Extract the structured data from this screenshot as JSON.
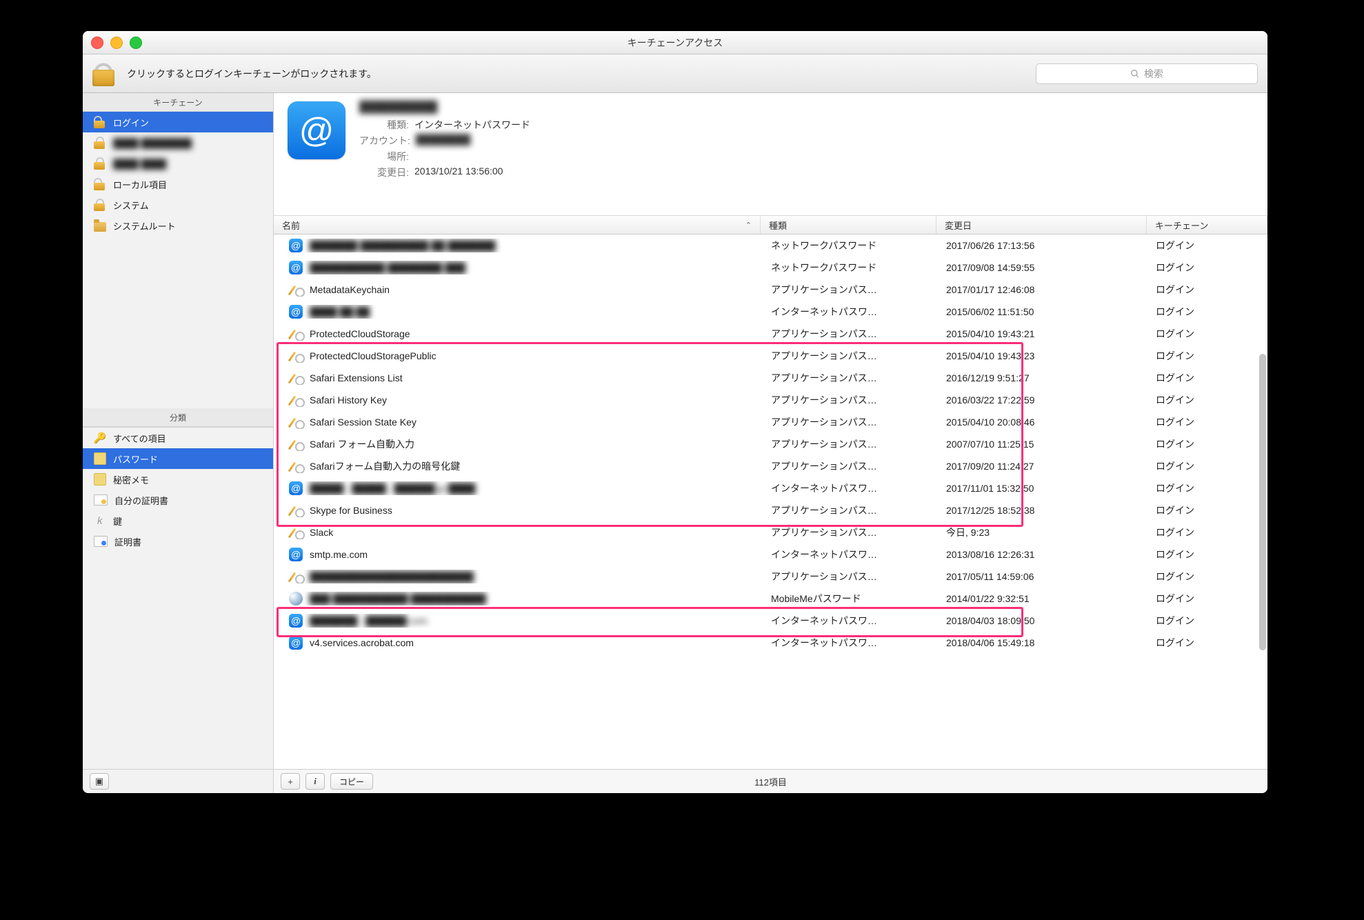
{
  "window": {
    "title": "キーチェーンアクセス"
  },
  "toolbar": {
    "hint": "クリックするとログインキーチェーンがロックされます。",
    "search_placeholder": "検索"
  },
  "sidebar": {
    "top_heading": "キーチェーン",
    "bottom_heading": "分類",
    "keychains": [
      {
        "label": "ログイン",
        "icon": "lock-open",
        "selected": true
      },
      {
        "label": "████ ████████",
        "icon": "lock-closed",
        "blur": true
      },
      {
        "label": "████ ████",
        "icon": "lock-closed",
        "blur": true
      },
      {
        "label": "ローカル項目",
        "icon": "lock-open"
      },
      {
        "label": "システム",
        "icon": "lock-closed"
      },
      {
        "label": "システムルート",
        "icon": "folder"
      }
    ],
    "categories": [
      {
        "label": "すべての項目",
        "icon": "keys"
      },
      {
        "label": "パスワード",
        "icon": "note",
        "selected": true
      },
      {
        "label": "秘密メモ",
        "icon": "note"
      },
      {
        "label": "自分の証明書",
        "icon": "certself"
      },
      {
        "label": "鍵",
        "icon": "key"
      },
      {
        "label": "証明書",
        "icon": "cert"
      }
    ]
  },
  "detail": {
    "name": "██████████",
    "labels": {
      "kind": "種類:",
      "account": "アカウント:",
      "location": "場所:",
      "modified": "変更日:"
    },
    "kind": "インターネットパスワード",
    "account": "████████",
    "location": "",
    "modified": "2013/10/21 13:56:00"
  },
  "table": {
    "headers": {
      "name": "名前",
      "kind": "種類",
      "date": "変更日",
      "chain": "キーチェーン"
    },
    "rows": [
      {
        "icon": "at",
        "name": "███████ ██████████ ██ ███████",
        "blur": true,
        "kind": "ネットワークパスワード",
        "date": "2017/06/26 17:13:56",
        "chain": "ログイン"
      },
      {
        "icon": "at",
        "name": "███████████ ████████ ███",
        "blur": true,
        "kind": "ネットワークパスワード",
        "date": "2017/09/08 14:59:55",
        "chain": "ログイン"
      },
      {
        "icon": "app",
        "name": "MetadataKeychain",
        "kind": "アプリケーションパス…",
        "date": "2017/01/17 12:46:08",
        "chain": "ログイン"
      },
      {
        "icon": "at",
        "name": "████ ██ ██",
        "blur": true,
        "kind": "インターネットパスワ…",
        "date": "2015/06/02 11:51:50",
        "chain": "ログイン"
      },
      {
        "icon": "app",
        "name": "ProtectedCloudStorage",
        "kind": "アプリケーションパス…",
        "date": "2015/04/10 19:43:21",
        "chain": "ログイン"
      },
      {
        "icon": "app",
        "name": "ProtectedCloudStoragePublic",
        "kind": "アプリケーションパス…",
        "date": "2015/04/10 19:43:23",
        "chain": "ログイン"
      },
      {
        "icon": "app",
        "name": "Safari Extensions List",
        "kind": "アプリケーションパス…",
        "date": "2016/12/19 9:51:27",
        "chain": "ログイン"
      },
      {
        "icon": "app",
        "name": "Safari History Key",
        "kind": "アプリケーションパス…",
        "date": "2016/03/22 17:22:59",
        "chain": "ログイン"
      },
      {
        "icon": "app",
        "name": "Safari Session State Key",
        "kind": "アプリケーションパス…",
        "date": "2015/04/10 20:08:46",
        "chain": "ログイン"
      },
      {
        "icon": "app",
        "name": "Safari フォーム自動入力",
        "kind": "アプリケーションパス…",
        "date": "2007/07/10 11:25:15",
        "chain": "ログイン"
      },
      {
        "icon": "app",
        "name": "Safariフォーム自動入力の暗号化鍵",
        "kind": "アプリケーションパス…",
        "date": "2017/09/20 11:24:27",
        "chain": "ログイン"
      },
      {
        "icon": "at",
        "name": "█████ . █████ . ██████.jp ████",
        "blur": true,
        "kind": "インターネットパスワ…",
        "date": "2017/11/01 15:32:50",
        "chain": "ログイン"
      },
      {
        "icon": "app",
        "name": "Skype for Business",
        "kind": "アプリケーションパス…",
        "date": "2017/12/25 18:52:38",
        "chain": "ログイン"
      },
      {
        "icon": "app",
        "name": "Slack",
        "kind": "アプリケーションパス…",
        "date": "今日, 9:23",
        "chain": "ログイン"
      },
      {
        "icon": "at",
        "name": "smtp.me.com",
        "kind": "インターネットパスワ…",
        "date": "2013/08/16 12:26:31",
        "chain": "ログイン"
      },
      {
        "icon": "app",
        "name": "████████████████████████",
        "blur": true,
        "kind": "アプリケーションパス…",
        "date": "2017/05/11 14:59:06",
        "chain": "ログイン"
      },
      {
        "icon": "globe",
        "name": "███ ███████████ ███████████",
        "blur": true,
        "kind": "MobileMeパスワード",
        "date": "2014/01/22 9:32:51",
        "chain": "ログイン"
      },
      {
        "icon": "at",
        "name": "███████ . ██████.com",
        "blur": true,
        "kind": "インターネットパスワ…",
        "date": "2018/04/03 18:09:50",
        "chain": "ログイン"
      },
      {
        "icon": "at",
        "name": "v4.services.acrobat.com",
        "kind": "インターネットパスワ…",
        "date": "2018/04/06 15:49:18",
        "chain": "ログイン"
      }
    ],
    "highlights": [
      {
        "start": 5,
        "end": 12
      },
      {
        "start": 17,
        "end": 17
      }
    ]
  },
  "footer": {
    "copy": "コピー",
    "count": "112項目"
  }
}
